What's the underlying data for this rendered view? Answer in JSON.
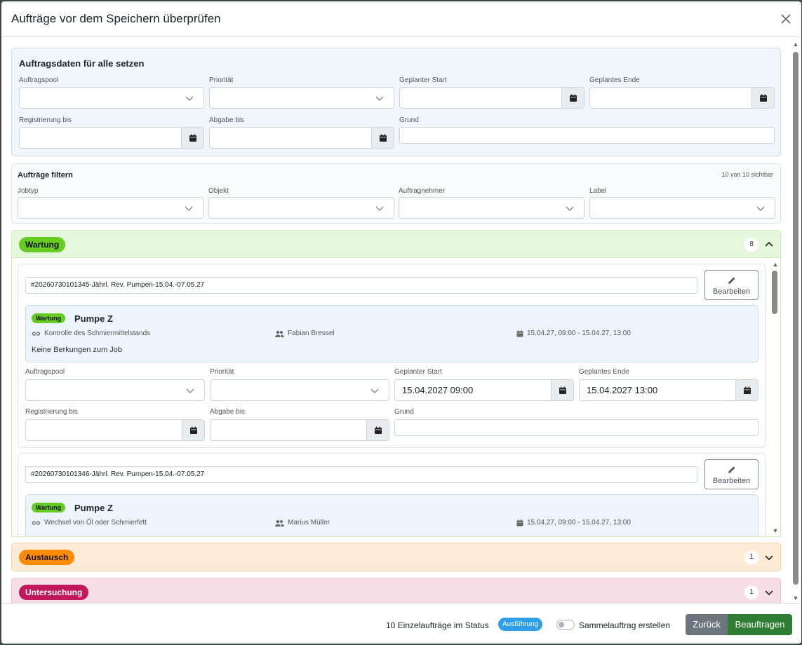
{
  "modal": {
    "title": "Aufträge vor dem Speichern überprüfen"
  },
  "bulk": {
    "title": "Auftragsdaten für alle setzen",
    "pool_label": "Auftragspool",
    "priority_label": "Priorität",
    "start_label": "Geplanter Start",
    "end_label": "Geplantes Ende",
    "registration_label": "Registrierung bis",
    "deadline_label": "Abgabe bis",
    "reason_label": "Grund"
  },
  "filter": {
    "title": "Aufträge filtern",
    "count_text": "10 von 10 sichtbar",
    "jobtype_label": "Jobtyp",
    "object_label": "Objekt",
    "contractor_label": "Auftragnehmer",
    "label_label": "Label"
  },
  "groups": [
    {
      "name": "Wartung",
      "count": "8",
      "color": "#66cc22",
      "bg": "#e6f8dc",
      "border": "#cdebbb"
    },
    {
      "name": "Austausch",
      "count": "1",
      "color": "#ff8c00",
      "bg": "#fdebd6",
      "border": "#f3d4ad"
    },
    {
      "name": "Untersuchung",
      "count": "1",
      "color": "#c2185b",
      "bg": "#f7dde6",
      "border": "#ecc3d2"
    }
  ],
  "jobs": [
    {
      "title": "#20260730101345-Jährl. Rev. Pumpen-15.04.-07.05.27",
      "edit_label": "Bearbeiten",
      "type": "Wartung",
      "object": "Pumpe Z",
      "task": "Kontrolle des Schmiermittelstands",
      "assignee": "Fabian Bressel",
      "time": "15.04.27, 09:00 - 15.04.27, 13:00",
      "description": "Keine Berkungen zum Job",
      "pool_label": "Auftragspool",
      "priority_label": "Priorität",
      "start_label": "Geplanter Start",
      "end_label": "Geplantes Ende",
      "start_value": "15.04.2027 09:00",
      "end_value": "15.04.2027 13:00",
      "registration_label": "Registrierung bis",
      "deadline_label": "Abgabe bis",
      "reason_label": "Grund"
    },
    {
      "title": "#20260730101346-Jährl. Rev. Pumpen-15.04.-07.05.27",
      "edit_label": "Bearbeiten",
      "type": "Wartung",
      "object": "Pumpe Z",
      "task": "Wechsel von Öl oder Schmierfett",
      "assignee": "Marius Müller",
      "time": "15.04.27, 09:00 - 15.04.27, 13:00"
    }
  ],
  "footer": {
    "summary": "10 Einzelaufträge im Status",
    "status": "Ausführung",
    "toggle_label": "Sammelauftrag erstellen",
    "back_label": "Zurück",
    "submit_label": "Beauftragen",
    "back_color": "#6c757d",
    "submit_color": "#2e7d32"
  }
}
